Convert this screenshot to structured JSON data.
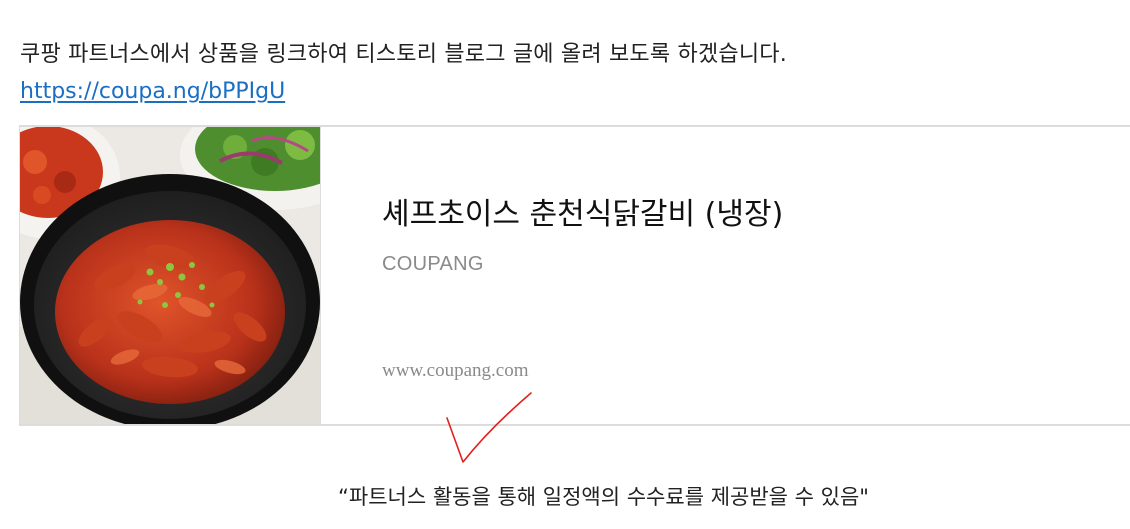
{
  "intro_text": "쿠팡 파트너스에서 상품을 링크하여 티스토리 블로그 글에 올려 보도록 하겠습니다.",
  "short_link": "https://coupa.ng/bPPIgU",
  "product_card": {
    "title": "셰프초이스 춘천식닭갈비 (냉장)",
    "source": "COUPANG",
    "url": "www.coupang.com",
    "thumbnail_icon": "dakgalbi-dish-image"
  },
  "annotation_icon": "red-checkmark-icon",
  "disclaimer": "“파트너스 활동을 통해 일정액의 수수료를 제공받을 수 있음\"",
  "colors": {
    "link": "#1a6fc4",
    "card_border": "#dcdcdc",
    "muted_text": "#8a8a8a",
    "checkmark": "#e3211c"
  }
}
